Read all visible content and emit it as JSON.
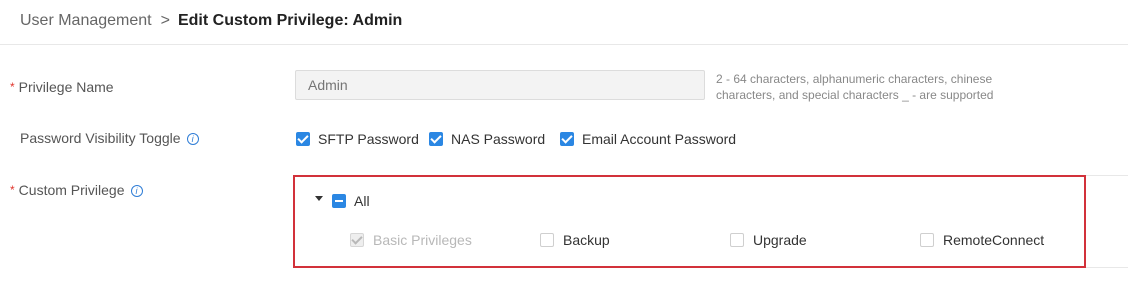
{
  "breadcrumb": {
    "parent": "User Management",
    "separator": ">",
    "current": "Edit Custom Privilege: Admin"
  },
  "form": {
    "privilege_name": {
      "label": "Privilege Name",
      "required_mark": "*",
      "placeholder": "Admin",
      "hint": "2 - 64 characters, alphanumeric characters, chinese characters, and special characters _ - are supported"
    },
    "password_visibility": {
      "label": "Password Visibility Toggle",
      "info_icon": "info-icon",
      "options": [
        {
          "label": "SFTP Password",
          "checked": true
        },
        {
          "label": "NAS Password",
          "checked": true
        },
        {
          "label": "Email Account Password",
          "checked": true
        }
      ]
    },
    "custom_privilege": {
      "label": "Custom Privilege",
      "required_mark": "*",
      "info_icon": "info-icon",
      "all_label": "All",
      "all_state": "indeterminate",
      "items": [
        {
          "label": "Basic Privileges",
          "checked": true,
          "disabled": true
        },
        {
          "label": "Backup",
          "checked": false,
          "disabled": false
        },
        {
          "label": "Upgrade",
          "checked": false,
          "disabled": false
        },
        {
          "label": "RemoteConnect",
          "checked": false,
          "disabled": false
        }
      ]
    }
  },
  "colors": {
    "accent": "#2b87e3",
    "required": "#e0352c",
    "highlight_border": "#d2313a"
  }
}
